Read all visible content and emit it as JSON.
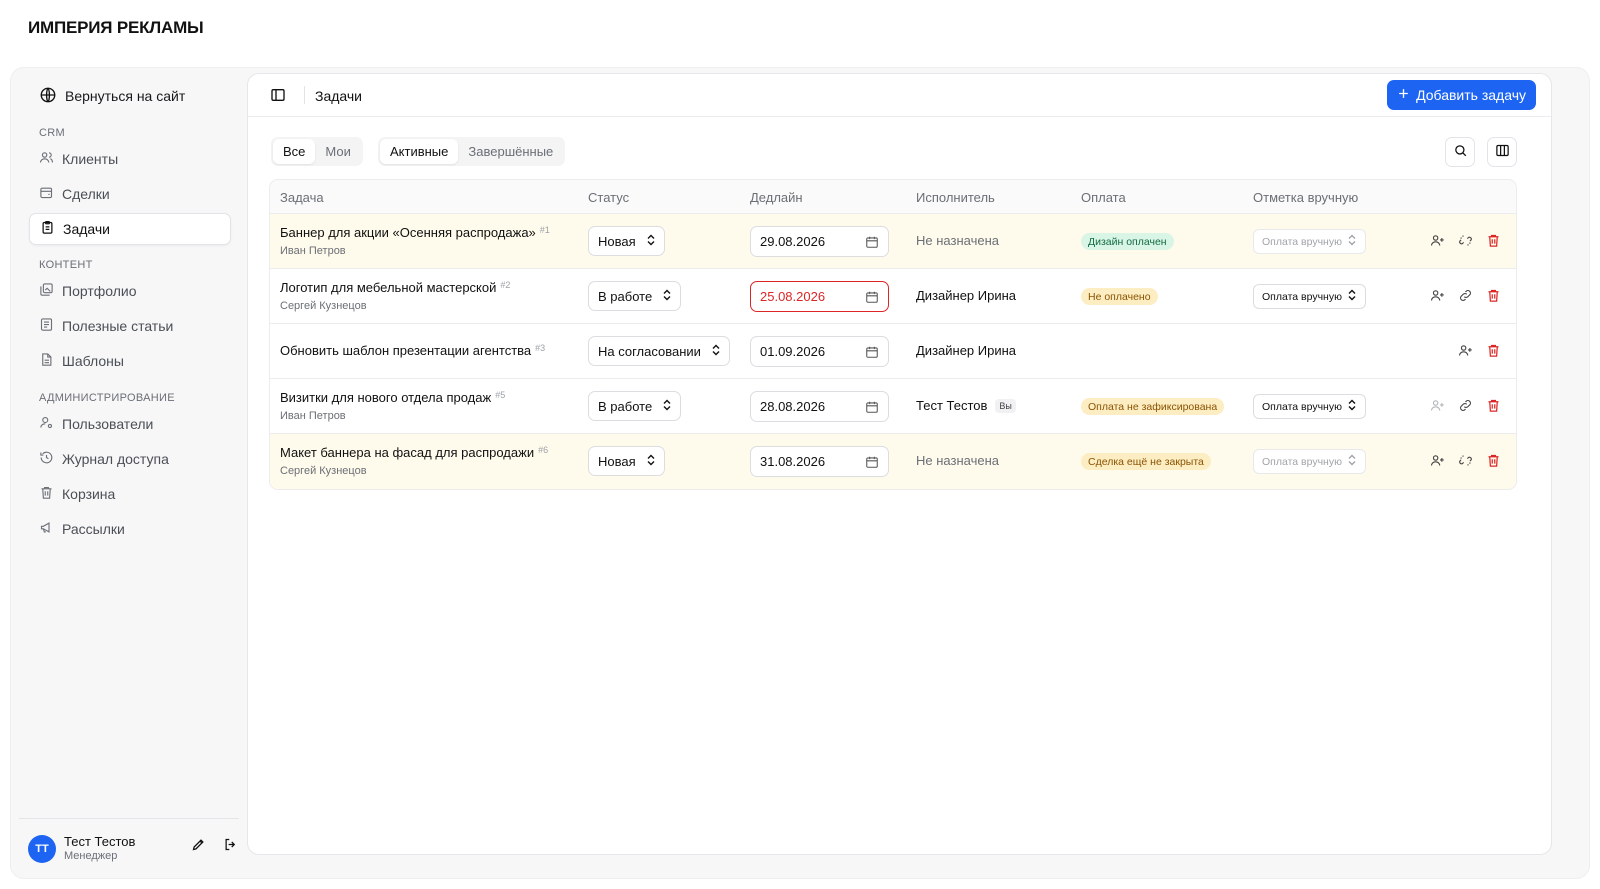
{
  "brand": "ИМПЕРИЯ РЕКЛАМЫ",
  "sidebar": {
    "back_link": "Вернуться на сайт",
    "sections": {
      "crm": "CRM",
      "content": "КОНТЕНТ",
      "admin": "АДМИНИСТРИРОВАНИЕ"
    },
    "items": [
      {
        "label": "Клиенты",
        "icon": "users-icon"
      },
      {
        "label": "Сделки",
        "icon": "deals-icon"
      },
      {
        "label": "Задачи",
        "icon": "clipboard-icon",
        "active": true
      },
      {
        "label": "Портфолио",
        "icon": "portfolio-icon"
      },
      {
        "label": "Полезные статьи",
        "icon": "articles-icon"
      },
      {
        "label": "Шаблоны",
        "icon": "file-icon"
      },
      {
        "label": "Пользователи",
        "icon": "user-gear-icon"
      },
      {
        "label": "Журнал доступа",
        "icon": "history-icon"
      },
      {
        "label": "Корзина",
        "icon": "trash-icon"
      },
      {
        "label": "Рассылки",
        "icon": "megaphone-icon"
      }
    ],
    "user": {
      "initials": "ТТ",
      "name": "Тест Тестов",
      "role": "Менеджер"
    }
  },
  "header": {
    "title": "Задачи",
    "add_button": "Добавить задачу"
  },
  "filters": {
    "owner": [
      "Все",
      "Мои"
    ],
    "state": [
      "Активные",
      "Завершённые"
    ],
    "selected_owner": "Все",
    "selected_state": "Активные"
  },
  "table": {
    "columns": [
      "Задача",
      "Статус",
      "Дедлайн",
      "Исполнитель",
      "Оплата",
      "Отметка вручную"
    ],
    "rows": [
      {
        "title": "Баннер для акции «Осенняя распродажа»",
        "num": "#1",
        "client": "Иван Петров",
        "status": "Новая",
        "deadline": "29.08.2026",
        "overdue": false,
        "assignee": "Не назначена",
        "payment": "Дизайн оплачен",
        "payment_tone": "green",
        "manual": "Оплата вручную",
        "manual_disabled": true,
        "highlight": true
      },
      {
        "title": "Логотип для мебельной мастерской",
        "num": "#2",
        "client": "Сергей Кузнецов",
        "status": "В работе",
        "deadline": "25.08.2026",
        "overdue": true,
        "assignee": "Дизайнер Ирина",
        "payment": "Не оплачено",
        "payment_tone": "amber",
        "manual": "Оплата вручную",
        "manual_disabled": false,
        "highlight": false
      },
      {
        "title": "Обновить шаблон презентации агентства",
        "num": "#3",
        "client": "",
        "status": "На согласовании",
        "deadline": "01.09.2026",
        "overdue": false,
        "assignee": "Дизайнер Ирина",
        "payment": "",
        "manual": "",
        "highlight": false
      },
      {
        "title": "Визитки для нового отдела продаж",
        "num": "#5",
        "client": "Иван Петров",
        "status": "В работе",
        "deadline": "28.08.2026",
        "overdue": false,
        "assignee": "Тест Тестов",
        "assignee_badge": "Вы",
        "payment": "Оплата не зафиксирована",
        "payment_tone": "amber",
        "manual": "Оплата вручную",
        "manual_disabled": false,
        "highlight": false
      },
      {
        "title": "Макет баннера на фасад для распродажи",
        "num": "#6",
        "client": "Сергей Кузнецов",
        "status": "Новая",
        "deadline": "31.08.2026",
        "overdue": false,
        "assignee": "Не назначена",
        "payment": "Сделка ещё не закрыта",
        "payment_tone": "amber",
        "manual": "Оплата вручную",
        "manual_disabled": true,
        "highlight": true
      }
    ]
  },
  "colors": {
    "accent": "#1d64f2",
    "danger": "#dc2626",
    "highlight_row": "#fffbec"
  }
}
